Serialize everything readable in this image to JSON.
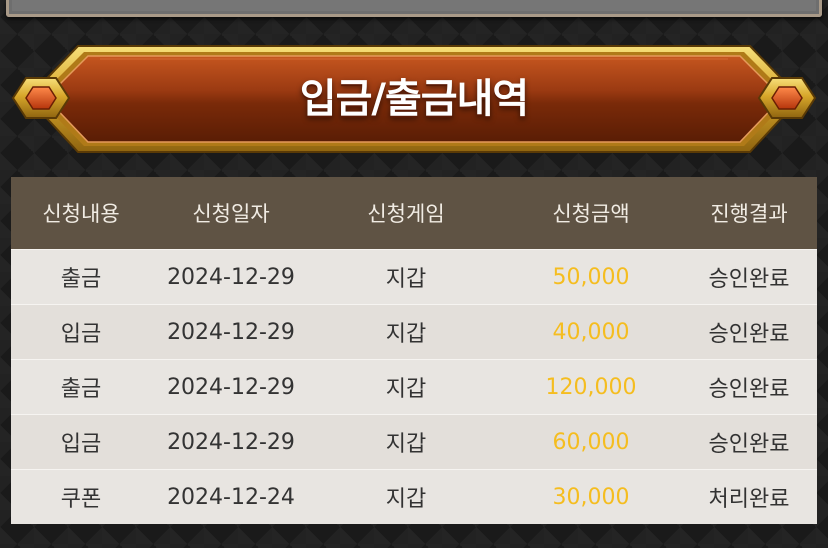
{
  "title": "입금/출금내역",
  "columns": [
    "신청내용",
    "신청일자",
    "신청게임",
    "신청금액",
    "진행결과"
  ],
  "rows": [
    {
      "type": "출금",
      "date": "2024-12-29",
      "game": "지갑",
      "amount": "50,000",
      "result": "승인완료"
    },
    {
      "type": "입금",
      "date": "2024-12-29",
      "game": "지갑",
      "amount": "40,000",
      "result": "승인완료"
    },
    {
      "type": "출금",
      "date": "2024-12-29",
      "game": "지갑",
      "amount": "120,000",
      "result": "승인완료"
    },
    {
      "type": "입금",
      "date": "2024-12-29",
      "game": "지갑",
      "amount": "60,000",
      "result": "승인완료"
    },
    {
      "type": "쿠폰",
      "date": "2024-12-24",
      "game": "지갑",
      "amount": "30,000",
      "result": "처리완료"
    }
  ],
  "colors": {
    "header_bg": "#5f5344",
    "row_bg": "#e8e5e1",
    "amount": "#f5bd1f",
    "banner_red": "#9c3c12",
    "banner_gold": "#d9a92a"
  }
}
